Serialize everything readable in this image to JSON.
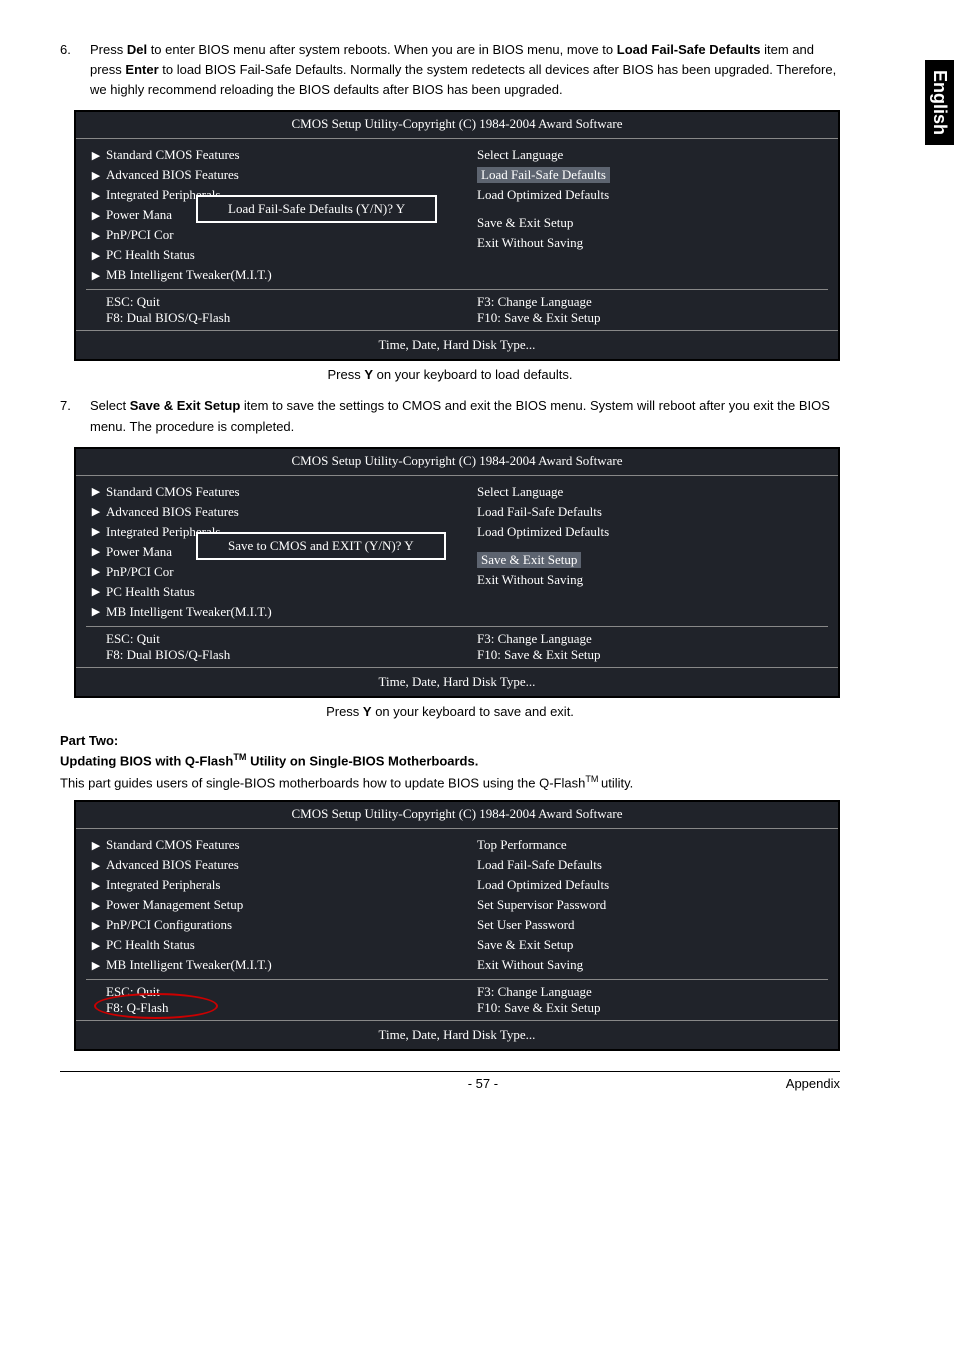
{
  "sideTab": "English",
  "step6": {
    "num": "6.",
    "t1": "Press ",
    "k1": "Del",
    "t2": " to enter BIOS menu after system reboots. When you are in BIOS menu, move to ",
    "k2": "Load Fail-Safe Defaults",
    "t3": " item and press ",
    "k3": "Enter",
    "t4": " to load BIOS Fail-Safe Defaults. Normally the system redetects all devices after BIOS has been upgraded. Therefore, we highly recommend reloading the BIOS defaults after BIOS has been upgraded."
  },
  "box1": {
    "title": "CMOS Setup Utility-Copyright (C) 1984-2004 Award Software",
    "left": [
      "Standard CMOS Features",
      "Advanced BIOS Features",
      "Integrated Peripherals",
      "Power Mana",
      "PnP/PCI Cor",
      "PC Health Status",
      "MB Intelligent Tweaker(M.I.T.)"
    ],
    "right": [
      "Select Language",
      "Load Fail-Safe Defaults",
      "Load Optimized Defaults",
      "",
      "",
      "Save & Exit Setup",
      "Exit Without Saving"
    ],
    "hlIndex": 1,
    "dialog": "Load Fail-Safe Defaults (Y/N)? Y",
    "footL": [
      "ESC: Quit",
      "F8: Dual BIOS/Q-Flash"
    ],
    "footR": [
      "F3: Change Language",
      "F10: Save & Exit Setup"
    ],
    "hint": "Time, Date, Hard Disk Type..."
  },
  "cap1a": "Press ",
  "cap1k": "Y",
  "cap1b": " on your keyboard to load defaults.",
  "step7": {
    "num": "7.",
    "t1": "Select ",
    "k1": "Save & Exit Setup",
    "t2": " item to save the settings to CMOS and exit the BIOS menu. System will reboot after you exit the BIOS menu. The procedure is completed."
  },
  "box2": {
    "title": "CMOS Setup Utility-Copyright (C) 1984-2004 Award Software",
    "left": [
      "Standard CMOS Features",
      "Advanced BIOS Features",
      "Integrated Peripherals",
      "Power Mana",
      "PnP/PCI Cor",
      "PC Health Status",
      "MB Intelligent Tweaker(M.I.T.)"
    ],
    "right": [
      "Select Language",
      "Load Fail-Safe Defaults",
      "Load Optimized Defaults",
      "",
      "",
      "Save & Exit Setup",
      "Exit Without Saving"
    ],
    "hlIndex": 5,
    "dialog": "Save to CMOS and EXIT (Y/N)? Y",
    "footL": [
      "ESC: Quit",
      "F8: Dual BIOS/Q-Flash"
    ],
    "footR": [
      "F3: Change Language",
      "F10: Save & Exit Setup"
    ],
    "hint": "Time, Date, Hard Disk Type..."
  },
  "cap2a": "Press ",
  "cap2k": "Y",
  "cap2b": " on your keyboard to save and exit.",
  "partTwo": "Part Two:",
  "partTwoSub_a": "Updating BIOS with Q-Flash",
  "partTwoSub_tm": "TM",
  "partTwoSub_b": " Utility on Single-BIOS Motherboards.",
  "partTwoDesc_a": "This part guides users of single-BIOS motherboards how to update BIOS using the Q-Flash",
  "partTwoDesc_tm": "TM ",
  "partTwoDesc_b": "utility.",
  "box3": {
    "title": "CMOS Setup Utility-Copyright (C) 1984-2004 Award Software",
    "left": [
      "Standard CMOS Features",
      "Advanced BIOS Features",
      "Integrated Peripherals",
      "Power Management Setup",
      "PnP/PCI Configurations",
      "PC Health Status",
      "MB Intelligent Tweaker(M.I.T.)"
    ],
    "right": [
      "Top Performance",
      "Load Fail-Safe Defaults",
      "Load Optimized Defaults",
      "Set Supervisor Password",
      "Set User Password",
      "Save & Exit Setup",
      "Exit Without Saving"
    ],
    "footL": [
      "ESC: Quit",
      "F8: Q-Flash"
    ],
    "footR": [
      "F3: Change Language",
      "F10: Save & Exit Setup"
    ],
    "hint": "Time, Date, Hard Disk Type..."
  },
  "pageNum": "- 57 -",
  "appendix": "Appendix"
}
